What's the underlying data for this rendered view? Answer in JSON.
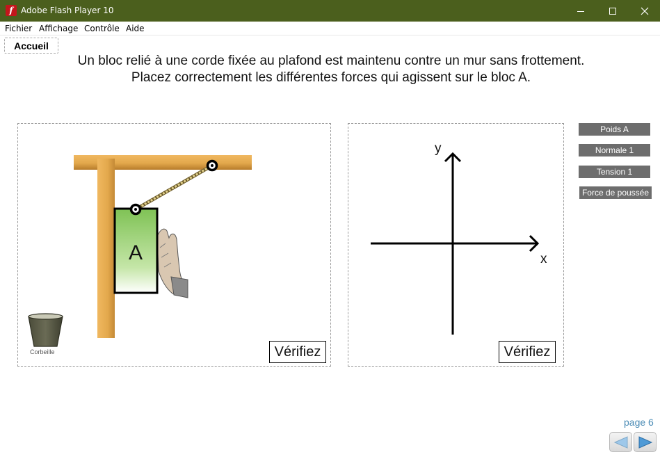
{
  "window": {
    "title": "Adobe Flash Player 10",
    "app_icon_glyph": "f"
  },
  "menu": [
    "Fichier",
    "Affichage",
    "Contrôle",
    "Aide"
  ],
  "home_label": "Accueil",
  "instructions": {
    "line1": "Un bloc relié à une corde fixée au plafond est maintenu contre un mur sans frottement.",
    "line2": "Placez correctement les différentes forces qui agissent sur le bloc A."
  },
  "scene": {
    "block_label": "A",
    "bin_label": "Corbeille",
    "verify_label": "Vérifiez"
  },
  "diagram": {
    "x_label": "x",
    "y_label": "y",
    "verify_label": "Vérifiez"
  },
  "forces": [
    "Poids A",
    "Normale 1",
    "Tension 1",
    "Force de poussée"
  ],
  "navigation": {
    "page_label": "page 6"
  },
  "colors": {
    "titlebar": "#4b5f1d",
    "beam": "#e3a84c",
    "block_green": "#8fcf65",
    "force_button": "#6d6d6d",
    "page_label": "#4a8bb5",
    "nav_arrow": "#4f9ad6"
  },
  "icons": [
    "flash-app-icon",
    "minimize-icon",
    "maximize-icon",
    "close-icon",
    "trash-bin-icon",
    "hand-icon",
    "prev-arrow-icon",
    "next-arrow-icon"
  ]
}
